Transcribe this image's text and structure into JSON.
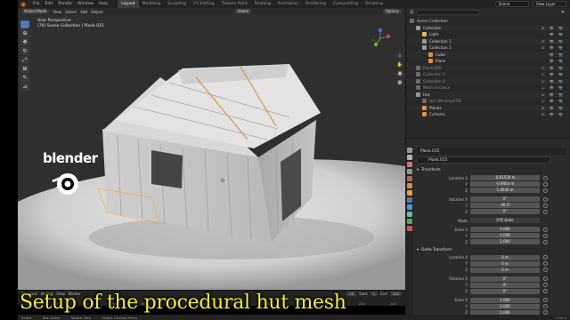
{
  "menu": {
    "items": [
      "File",
      "Edit",
      "Render",
      "Window",
      "Help"
    ],
    "workspaces": [
      "Layout",
      "Modeling",
      "Sculpting",
      "UV Editing",
      "Texture Paint",
      "Shading",
      "Animation",
      "Rendering",
      "Compositing",
      "Scripting"
    ],
    "active_workspace": "Layout",
    "scene": "Scene",
    "view_layer": "View Layer"
  },
  "viewport_header": {
    "mode": "Object Mode",
    "menus": [
      "View",
      "Select",
      "Add",
      "Object"
    ],
    "orientation": "Global",
    "options": "Options"
  },
  "viewport": {
    "view_name": "User Perspective",
    "collection_path": "(76) Scene Collection | Plank.015"
  },
  "outliner": {
    "rows": [
      {
        "label": "Scene Collection",
        "indent": 0,
        "color": "#6c6c6c",
        "dim": false,
        "vis": ""
      },
      {
        "label": "Collection",
        "indent": 1,
        "color": "#9a9a9a",
        "dim": false,
        "vis": "☑ 👁 📷"
      },
      {
        "label": "Light",
        "indent": 2,
        "color": "#e0c060",
        "dim": false,
        "vis": "👁 📷"
      },
      {
        "label": "Collection 1",
        "indent": 2,
        "color": "#9a9a9a",
        "dim": false,
        "vis": "☑ 👁 📷"
      },
      {
        "label": "Collection 2",
        "indent": 2,
        "color": "#9a9a9a",
        "dim": false,
        "vis": "☑ 👁 📷"
      },
      {
        "label": "Cube",
        "indent": 3,
        "color": "#e09050",
        "dim": false,
        "vis": "👁 📷"
      },
      {
        "label": "Plane",
        "indent": 3,
        "color": "#e09050",
        "dim": false,
        "vis": "👁 📷"
      },
      {
        "label": "Plank.009",
        "indent": 1,
        "color": "#6c6c6c",
        "dim": true,
        "vis": "☐ 👁 📷"
      },
      {
        "label": "Collection 3",
        "indent": 1,
        "color": "#6c6c6c",
        "dim": true,
        "vis": "☐ 👁 📷"
      },
      {
        "label": "Collection 4",
        "indent": 1,
        "color": "#6c6c6c",
        "dim": true,
        "vis": "☐ 👁 📷"
      },
      {
        "label": "Mesh Instance",
        "indent": 1,
        "color": "#6c6c6c",
        "dim": true,
        "vis": "☐ 👁 📷"
      },
      {
        "label": "Hut",
        "indent": 1,
        "color": "#9a9a9a",
        "dim": false,
        "vis": "☑ 👁 📷"
      },
      {
        "label": "Hut Working EDO",
        "indent": 2,
        "color": "#6c6c6c",
        "dim": true,
        "vis": "☐ 👁 📷"
      },
      {
        "label": "Planks",
        "indent": 2,
        "color": "#e09050",
        "dim": false,
        "vis": "☑ 👁 📷"
      },
      {
        "label": "Curtains",
        "indent": 2,
        "color": "#e09050",
        "dim": false,
        "vis": "☑ 👁 📷"
      }
    ]
  },
  "properties": {
    "object_label": "Plank.015",
    "object_name": "Plank.015",
    "transform_title": "Transform",
    "location": {
      "label": "Location X",
      "x": "-0.61528 m",
      "y": "-0.9464 m",
      "z": "1.4542 m"
    },
    "rotation": {
      "label": "Rotation X",
      "x": "0°",
      "y": "-36.5°",
      "z": "0°"
    },
    "mode_label": "Mode",
    "mode_value": "XYZ Euler",
    "scale": {
      "label": "Scale X",
      "x": "1.000",
      "y": "1.000",
      "z": "1.000"
    },
    "delta_title": "Delta Transform",
    "delta_location": {
      "label": "Location X",
      "x": "0 m",
      "y": "0 m",
      "z": "0 m"
    },
    "delta_rotation": {
      "label": "Rotation X",
      "x": "0°",
      "y": "0°",
      "z": "0°"
    },
    "delta_scale": {
      "label": "Scale X",
      "x": "1.000",
      "y": "1.000",
      "z": "1.000"
    },
    "axis_y": "Y",
    "axis_z": "Z"
  },
  "timeline": {
    "menus": [
      "Playback",
      "Keying",
      "View",
      "Marker"
    ],
    "start_label": "Start",
    "start": "1",
    "end_label": "End",
    "end": "250",
    "current": "76",
    "ticks": [
      "0",
      "20",
      "40",
      "60",
      "80",
      "100",
      "120",
      "140",
      "160",
      "180",
      "200",
      "220",
      "240"
    ]
  },
  "statusbar": {
    "items": [
      "Select",
      "Box Select",
      "Rotate View",
      "Object Context Menu"
    ],
    "version": "2.92.0"
  },
  "logo_text": "blender",
  "caption": "Setup of the procedural hut mesh",
  "colors": {
    "accent": "#4772b3",
    "caption": "#f4ef3a",
    "orange": "#e87d0d"
  }
}
